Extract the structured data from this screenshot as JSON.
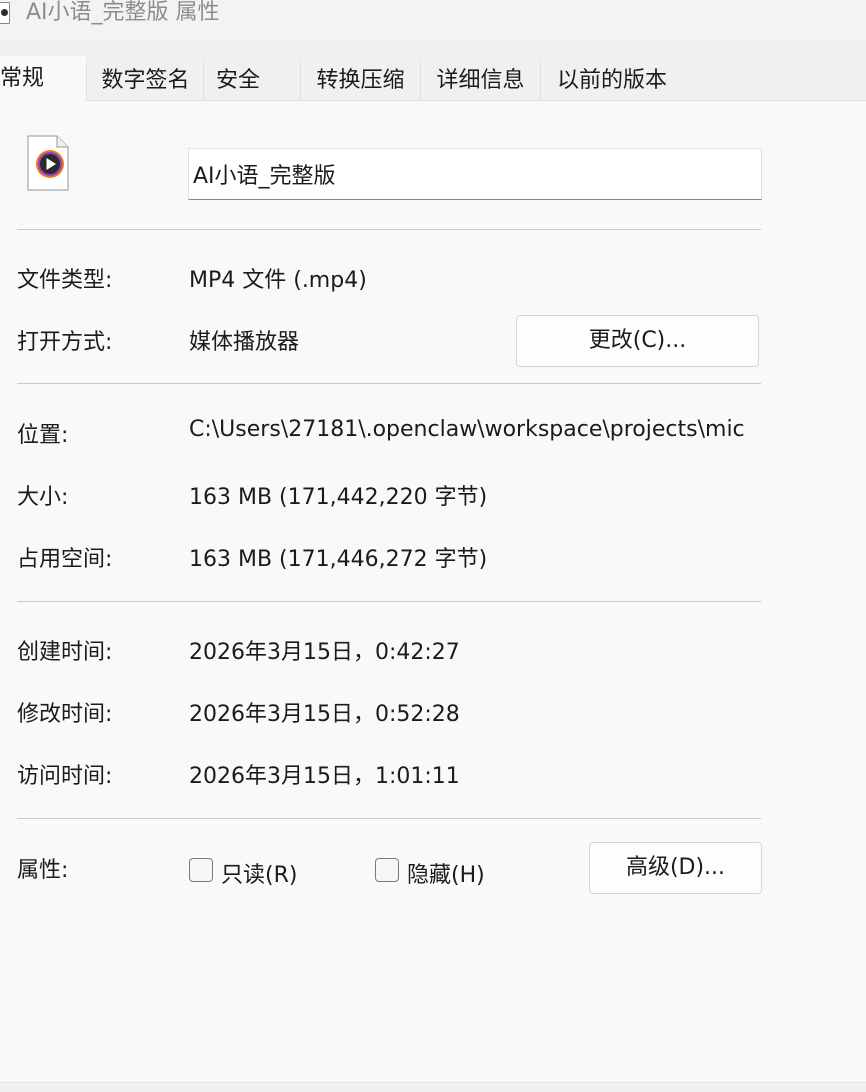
{
  "window": {
    "title": "AI小语_完整版 属性"
  },
  "tabs": [
    {
      "label": "常规",
      "active": true
    },
    {
      "label": "数字签名",
      "active": false
    },
    {
      "label": "安全",
      "active": false
    },
    {
      "label": "转换压缩",
      "active": false
    },
    {
      "label": "详细信息",
      "active": false
    },
    {
      "label": "以前的版本",
      "active": false
    }
  ],
  "file": {
    "name": "AI小语_完整版",
    "icon": "video-file-icon",
    "icon_colors": {
      "ring_outer": "#f27a1a",
      "ring_inner": "#8a3fd1",
      "center": "#2b2b2b"
    }
  },
  "general": {
    "type_label": "文件类型:",
    "type_value": "MP4 文件 (.mp4)",
    "open_with_label": "打开方式:",
    "open_with_value": "媒体播放器",
    "change_button": "更改(C)...",
    "location_label": "位置:",
    "location_value": "C:\\Users\\27181\\.openclaw\\workspace\\projects\\mic",
    "size_label": "大小:",
    "size_value": "163 MB (171,442,220 字节)",
    "size_on_disk_label": "占用空间:",
    "size_on_disk_value": "163 MB (171,446,272 字节)",
    "created_label": "创建时间:",
    "created_value": "2026年3月15日，0:42:27",
    "modified_label": "修改时间:",
    "modified_value": "2026年3月15日，0:52:28",
    "accessed_label": "访问时间:",
    "accessed_value": "2026年3月15日，1:01:11",
    "attributes_label": "属性:",
    "readonly_label": "只读(R)",
    "readonly_checked": false,
    "hidden_label": "隐藏(H)",
    "hidden_checked": false,
    "advanced_button": "高级(D)..."
  }
}
